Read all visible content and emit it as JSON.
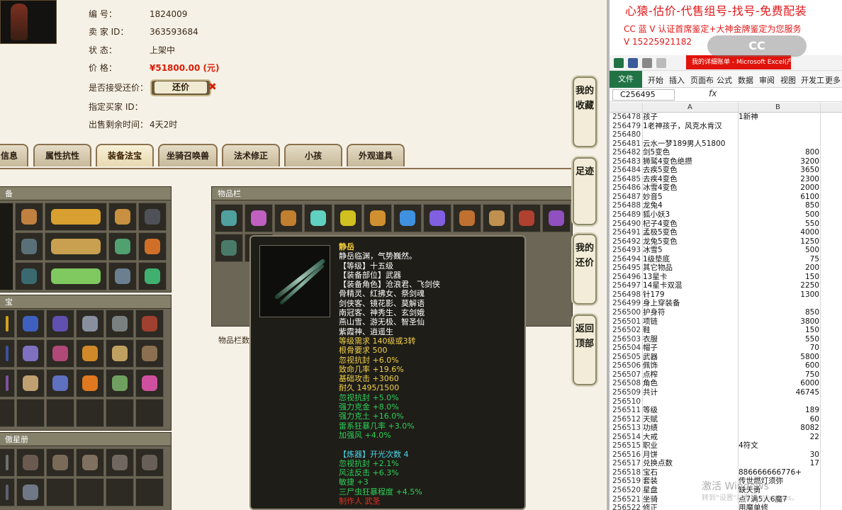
{
  "listing": {
    "rows": [
      {
        "label": "编        号：",
        "value": "1824009"
      },
      {
        "label": "卖  家  ID：",
        "value": "363593684"
      },
      {
        "label": "状        态：",
        "value": "上架中"
      },
      {
        "label": "价        格：",
        "value": "¥51800.00 (元)"
      },
      {
        "label": "是否接受还价：",
        "value": ""
      },
      {
        "label": "指定买家 ID：",
        "value": ""
      },
      {
        "label": "出售剩余时间：",
        "value": "4天2时"
      }
    ],
    "counter_offer_label": "还价",
    "close_symbol": "✖"
  },
  "tabs": [
    "信息",
    "属性抗性",
    "装备法宝",
    "坐骑召唤兽",
    "法术修正",
    "小孩",
    "外观道具"
  ],
  "active_tab": 2,
  "panels": {
    "equip_header": "备",
    "treasure_header": "宝",
    "star_header": "傲星册",
    "inventory_header": "物品栏",
    "inventory_footer": "物品栏数"
  },
  "side_nav": [
    "我的收藏",
    "足迹",
    "我的还价",
    "返回顶部"
  ],
  "tooltip": {
    "name": "静岳",
    "lines": [
      {
        "t": "静岳临渊，气势巍然。",
        "c": "w"
      },
      {
        "t": "【等级】十五级",
        "c": "w"
      },
      {
        "t": "【装备部位】武器",
        "c": "w"
      },
      {
        "t": "【装备角色】沧浪君、飞剑侠",
        "c": "w"
      },
      {
        "t": "骨精灵、红拂女、祭剑魂",
        "c": "w"
      },
      {
        "t": "剑侠客、镜花影、莫解语",
        "c": "w"
      },
      {
        "t": "南冠客、神秀生、玄剑娥",
        "c": "w"
      },
      {
        "t": "燕山雪、游无极、智圣仙",
        "c": "w"
      },
      {
        "t": "紫霞神、逍遥生",
        "c": "w"
      },
      {
        "t": "等级需求 140级或3转",
        "c": "y"
      },
      {
        "t": "根骨要求 500",
        "c": "y"
      },
      {
        "t": "忽视抗封 +6.0%",
        "c": "y"
      },
      {
        "t": "致命几率 +19.6%",
        "c": "y"
      },
      {
        "t": "基础攻击 +3060",
        "c": "y"
      },
      {
        "t": "耐久 1495/1500",
        "c": "y"
      },
      {
        "t": "忽视抗封 +5.0%",
        "c": "g"
      },
      {
        "t": "强力克金 +8.0%",
        "c": "g"
      },
      {
        "t": "强力克土 +16.0%",
        "c": "g"
      },
      {
        "t": "雷系狂暴几率 +3.0%",
        "c": "g"
      },
      {
        "t": "加强风 +4.0%",
        "c": "g"
      },
      {
        "t": "",
        "c": "w"
      },
      {
        "t": "【炼器】开光次数 4",
        "c": "c"
      },
      {
        "t": "忽视抗封 +2.1%",
        "c": "g"
      },
      {
        "t": "风法反击 +6.3%",
        "c": "g"
      },
      {
        "t": "敏捷 +3",
        "c": "g"
      },
      {
        "t": "三尸虫狂暴程度 +4.5%",
        "c": "g"
      },
      {
        "t": "制作人 武圣",
        "c": "r"
      }
    ]
  },
  "promo": {
    "line1": "心猿-估价-代售组号-找号-免费配装",
    "line2": "CC 蓝 V 认证首席鉴定+大神金牌鉴定为您服务",
    "line3": "V 15225921182"
  },
  "excel": {
    "taskbar": "我的详细账单 - Microsoft Excel(产品...",
    "ribbon_tabs": [
      "文件",
      "开始",
      "插入",
      "页面布",
      "公式",
      "数据",
      "审阅",
      "视图",
      "开发工",
      "更多"
    ],
    "namebox": "C256495",
    "fx": "fx",
    "col_a": "A",
    "col_b": "B",
    "rows": [
      {
        "n": "256478",
        "a": "孩子",
        "b": "1新神",
        "bl": true
      },
      {
        "n": "256479",
        "a": "1老神孩子，风克水肯汉",
        "b": ""
      },
      {
        "n": "256480",
        "a": "",
        "b": ""
      },
      {
        "n": "256481",
        "a": "云水一梦189男人51800",
        "b": ""
      },
      {
        "n": "256482",
        "a": "剑5变色",
        "b": "800"
      },
      {
        "n": "256483",
        "a": "狮鹫4变色绝攒",
        "b": "3200"
      },
      {
        "n": "256484",
        "a": "去疾5变色",
        "b": "3650"
      },
      {
        "n": "256485",
        "a": "去疾4变色",
        "b": "2300"
      },
      {
        "n": "256486",
        "a": "冰雪4变色",
        "b": "2000"
      },
      {
        "n": "256487",
        "a": "妙音5",
        "b": "6100"
      },
      {
        "n": "256488",
        "a": "龙兔4",
        "b": "850"
      },
      {
        "n": "256489",
        "a": "狐小妖3",
        "b": "500"
      },
      {
        "n": "256490",
        "a": "杞子4变色",
        "b": "550"
      },
      {
        "n": "256491",
        "a": "孟极5变色",
        "b": "4000"
      },
      {
        "n": "256492",
        "a": "龙兔5变色",
        "b": "1250"
      },
      {
        "n": "256493",
        "a": "冰雪5",
        "b": "500"
      },
      {
        "n": "256494",
        "a": "1级垫底",
        "b": "75"
      },
      {
        "n": "256495",
        "a": "其它物品",
        "b": "200"
      },
      {
        "n": "256496",
        "a": "13星卡",
        "b": "150"
      },
      {
        "n": "256497",
        "a": "14星卡双混",
        "b": "2250"
      },
      {
        "n": "256498",
        "a": "针179",
        "b": "1300"
      },
      {
        "n": "256499",
        "a": "身上穿装备",
        "b": ""
      },
      {
        "n": "256500",
        "a": "护身符",
        "b": "850"
      },
      {
        "n": "256501",
        "a": "项链",
        "b": "3800"
      },
      {
        "n": "256502",
        "a": "鞋",
        "b": "150"
      },
      {
        "n": "256503",
        "a": "衣服",
        "b": "550"
      },
      {
        "n": "256504",
        "a": "帽子",
        "b": "70"
      },
      {
        "n": "256505",
        "a": "武器",
        "b": "5800"
      },
      {
        "n": "256506",
        "a": "佩饰",
        "b": "600"
      },
      {
        "n": "256507",
        "a": "点榨",
        "b": "750"
      },
      {
        "n": "256508",
        "a": "角色",
        "b": "6000"
      },
      {
        "n": "256509",
        "a": "共计",
        "b": "46745"
      },
      {
        "n": "256510",
        "a": "",
        "b": ""
      },
      {
        "n": "256511",
        "a": "等级",
        "b": "189"
      },
      {
        "n": "256512",
        "a": "天赋",
        "b": "60"
      },
      {
        "n": "256513",
        "a": "功绩",
        "b": "8082"
      },
      {
        "n": "256514",
        "a": "大戒",
        "b": "22"
      },
      {
        "n": "256515",
        "a": "职业",
        "b": "4符文",
        "bl": true
      },
      {
        "n": "256516",
        "a": "月饼",
        "b": "30"
      },
      {
        "n": "256517",
        "a": "兑换点数",
        "b": "17"
      },
      {
        "n": "256518",
        "a": "宝石",
        "b": "886666666776+",
        "bl": true
      },
      {
        "n": "256519",
        "a": "套装",
        "b": "传世燃灯须弥",
        "bl": true
      },
      {
        "n": "256520",
        "a": "星盘",
        "b": "缺天勇",
        "bl": true
      },
      {
        "n": "256521",
        "a": "坐骑",
        "b": "点7满5人6魔7",
        "bl": true
      },
      {
        "n": "256522",
        "a": "修正",
        "b": "用魔单修",
        "bl": true
      }
    ],
    "watermark": "激活 Windows",
    "watermark2": "转到\"设置\"以激活 Windows。",
    "logo": "CC"
  },
  "colors": {
    "price": "#d81e06",
    "promo": "#e0181a",
    "excel_green": "#217346"
  }
}
